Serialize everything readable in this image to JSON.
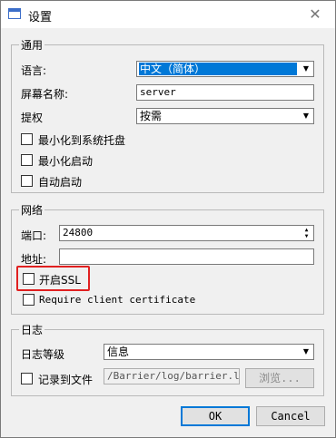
{
  "window": {
    "title": "设置",
    "close_symbol": "✕"
  },
  "general": {
    "group_label": "通用",
    "language_label": "语言:",
    "language_value": "中文（简体）",
    "screen_name_label": "屏幕名称:",
    "screen_name_value": "server",
    "elevate_label": "提权",
    "elevate_value": "按需",
    "minimize_tray_label": "最小化到系统托盘",
    "start_minimized_label": "最小化启动",
    "autostart_label": "自动启动"
  },
  "network": {
    "group_label": "网络",
    "port_label": "端口:",
    "port_value": "24800",
    "address_label": "地址:",
    "address_value": "",
    "enable_ssl_label": "开启SSL",
    "require_cert_label": "Require client certificate"
  },
  "log": {
    "group_label": "日志",
    "level_label": "日志等级",
    "level_value": "信息",
    "log_to_file_label": "记录到文件",
    "log_path_value": "/Barrier/log/barrier.log",
    "browse_label": "浏览..."
  },
  "buttons": {
    "ok": "OK",
    "cancel": "Cancel"
  },
  "colors": {
    "selection": "#0078d7",
    "highlight_box": "#e02020"
  }
}
